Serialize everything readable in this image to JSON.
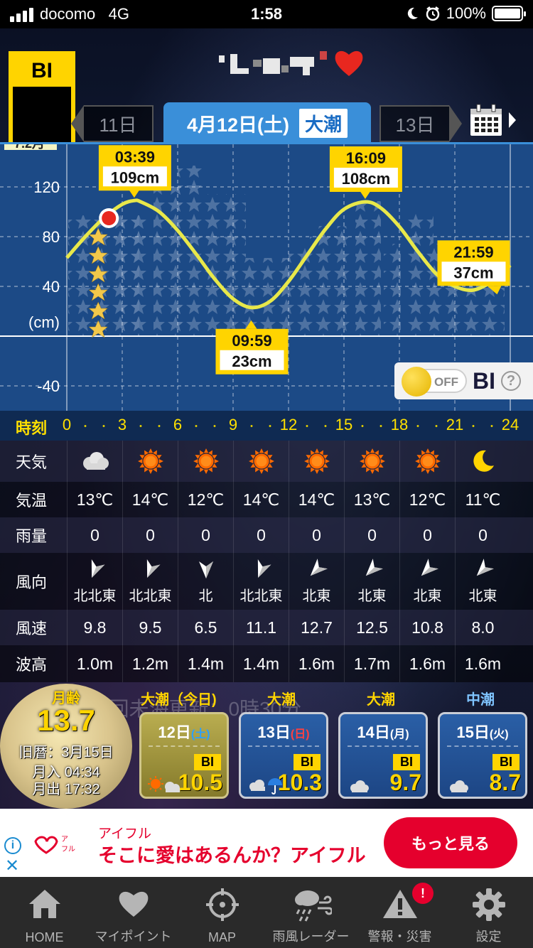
{
  "status_bar": {
    "carrier": "docomo",
    "network": "4G",
    "time": "1:58",
    "battery": "100%"
  },
  "header": {
    "logo_text": "BI",
    "prev_day": "11日",
    "current_date": "4月12日(土)",
    "tide_type": "大潮",
    "next_day": "13日"
  },
  "chart": {
    "y_tick_labels": [
      "120",
      "80",
      "40",
      "(cm)",
      "-40"
    ],
    "top_cut_label": "7.2月",
    "annotations": [
      {
        "time": "03:39",
        "height": "109cm"
      },
      {
        "time": "09:59",
        "height": "23cm"
      },
      {
        "time": "16:09",
        "height": "108cm"
      },
      {
        "time": "21:59",
        "height": "37cm"
      }
    ],
    "bi_toggle": {
      "state": "OFF",
      "label": "BI",
      "help": "?"
    }
  },
  "chart_data": {
    "type": "line",
    "x": [
      0,
      1,
      2,
      3,
      3.65,
      4,
      5,
      6,
      7,
      8,
      9,
      9.98,
      11,
      12,
      13,
      14,
      15,
      16.15,
      17,
      18,
      19,
      20,
      21,
      21.98,
      23,
      24
    ],
    "series": [
      {
        "values": [
          63,
          80,
          95,
          106,
          109,
          108,
          100,
          85,
          66,
          46,
          30,
          23,
          28,
          44,
          65,
          86,
          102,
          108,
          103,
          88,
          68,
          50,
          40,
          37,
          44,
          57
        ]
      }
    ],
    "xlim": [
      0,
      24
    ],
    "ylim": [
      -50,
      155
    ],
    "x_ticks": [
      0,
      3,
      6,
      9,
      12,
      15,
      18,
      21,
      24
    ],
    "y_ticks": [
      -40,
      0,
      40,
      80,
      120
    ],
    "ylabel": "(cm)",
    "current_time": 1.7,
    "grid": true
  },
  "time_axis": {
    "label": "時刻",
    "ticks": [
      "0",
      "3",
      "6",
      "9",
      "12",
      "15",
      "18",
      "21",
      "24"
    ]
  },
  "weather": {
    "rows": [
      {
        "label": "天気",
        "icons": [
          "cloud-icon",
          "sun-icon",
          "sun-icon",
          "sun-icon",
          "sun-icon",
          "sun-icon",
          "sun-icon",
          "moon-icon"
        ]
      },
      {
        "label": "気温",
        "values": [
          "13℃",
          "14℃",
          "12℃",
          "14℃",
          "14℃",
          "13℃",
          "12℃",
          "11℃"
        ]
      },
      {
        "label": "雨量",
        "values": [
          "0",
          "0",
          "0",
          "0",
          "0",
          "0",
          "0",
          "0"
        ]
      },
      {
        "label": "風向",
        "values": [
          "北北東",
          "北北東",
          "北",
          "北北東",
          "北東",
          "北東",
          "北東",
          "北東"
        ]
      },
      {
        "label": "風速",
        "values": [
          "9.8",
          "9.5",
          "6.5",
          "11.1",
          "12.7",
          "12.5",
          "10.8",
          "8.0"
        ]
      },
      {
        "label": "波高",
        "values": [
          "1.0m",
          "1.2m",
          "1.4m",
          "1.4m",
          "1.6m",
          "1.7m",
          "1.6m",
          "1.6m"
        ]
      }
    ],
    "wind_angles_deg": [
      22,
      22,
      0,
      22,
      45,
      45,
      45,
      45
    ]
  },
  "moon": {
    "age_label": "月齢",
    "age": "13.7",
    "lunar_date": "旧暦：3月15日",
    "moonset": "月入 04:34",
    "moonrise": "月出 17:32"
  },
  "ticker": "※回未海更新：0時30分",
  "days": [
    {
      "tide": "大潮（今日)",
      "day": "12日",
      "dow": "(土)",
      "bi_label": "BI",
      "score": "10.5"
    },
    {
      "tide": "大潮",
      "day": "13日",
      "dow": "(日)",
      "bi_label": "BI",
      "score": "10.3"
    },
    {
      "tide": "大潮",
      "day": "14日",
      "dow": "(月)",
      "bi_label": "BI",
      "score": "9.7"
    },
    {
      "tide": "中潮",
      "day": "15日",
      "dow": "(火)",
      "bi_label": "BI",
      "score": "8.7"
    }
  ],
  "ad": {
    "brand": "アイフル",
    "copy": "そこに愛はあるんか？アイフル",
    "cta": "もっと見る"
  },
  "tabbar": {
    "items": [
      "HOME",
      "マイポイント",
      "MAP",
      "雨風レーダー",
      "警報・災害",
      "設定"
    ],
    "badge": "!"
  },
  "colors": {
    "accent_blue": "#3a8fd9",
    "tide_line": "#e8e84a",
    "label_yellow": "#ffd400",
    "ad_red": "#e5002d"
  }
}
